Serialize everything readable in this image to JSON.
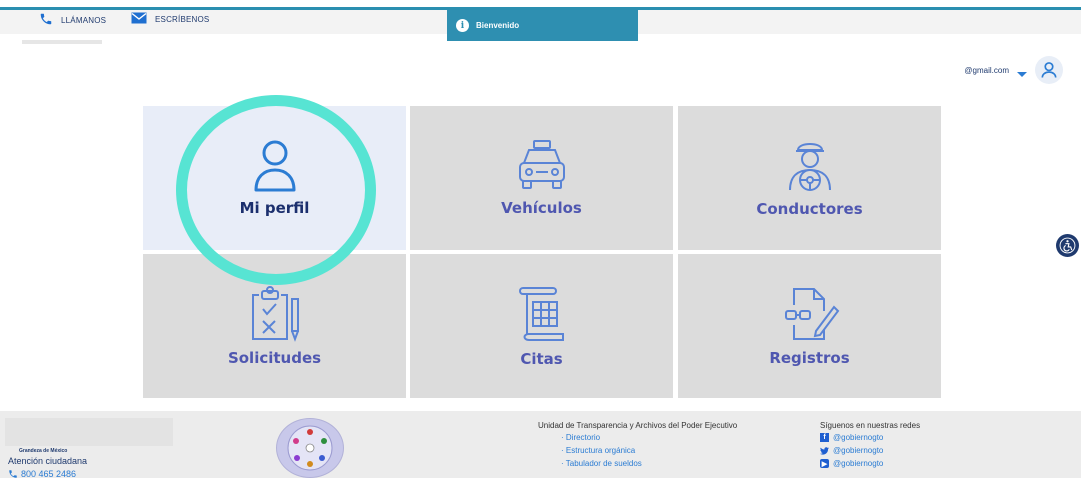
{
  "topbar": {
    "call_label": "LLÁMANOS",
    "write_label": "ESCRÍBENOS"
  },
  "toast": {
    "message": "Bienvenido",
    "icon": "info-icon",
    "color": "#2e8fb1"
  },
  "user": {
    "email": "@gmail.com",
    "icon": "user-icon"
  },
  "tiles": [
    {
      "label": "Mi perfil",
      "icon": "user-icon"
    },
    {
      "label": "Vehículos",
      "icon": "taxi-icon"
    },
    {
      "label": "Conductores",
      "icon": "driver-icon"
    },
    {
      "label": "Solicitudes",
      "icon": "clipboard-checklist-icon"
    },
    {
      "label": "Citas",
      "icon": "calendar-scroll-icon"
    },
    {
      "label": "Registros",
      "icon": "document-edit-icon"
    }
  ],
  "footer": {
    "brand_small": "Grandeza de México",
    "attention": "Atención ciudadana",
    "phone": "800 465 2486",
    "transparency_title": "Unidad de Transparencia y Archivos del Poder Ejecutivo",
    "transparency_links": [
      "· Directorio",
      "· Estructura orgánica",
      "· Tabulador de sueldos"
    ],
    "social_title": "Síguenos en nuestras redes",
    "social": [
      {
        "network": "facebook-icon",
        "handle": "@gobiernogto"
      },
      {
        "network": "twitter-icon",
        "handle": "@gobiernogto"
      },
      {
        "network": "youtube-icon",
        "handle": "@gobiernogto"
      }
    ]
  },
  "colors": {
    "accent": "#2e8fb1",
    "tile_label": "#4f57b0",
    "highlight_ring": "#57e4d3",
    "navy": "#1f3a6e"
  }
}
